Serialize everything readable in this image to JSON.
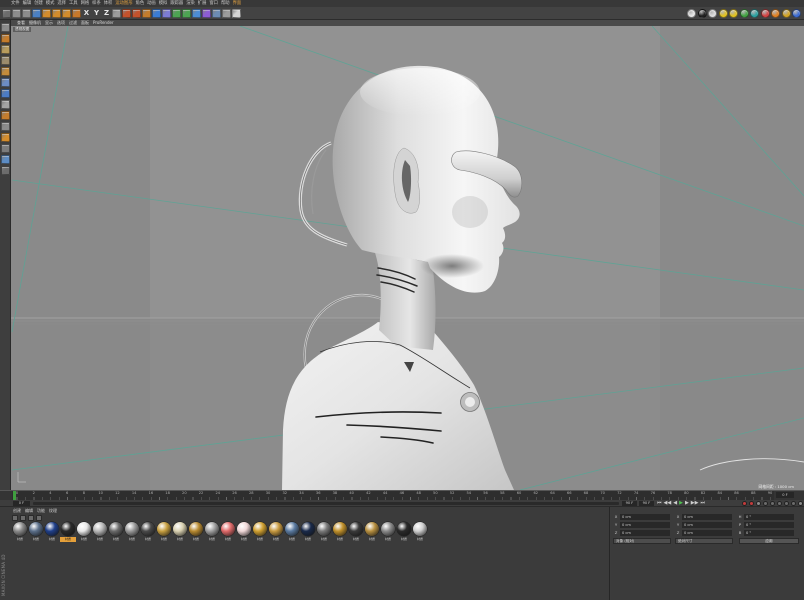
{
  "menubar": {
    "items": [
      {
        "label": "文件"
      },
      {
        "label": "编辑"
      },
      {
        "label": "创建"
      },
      {
        "label": "模式"
      },
      {
        "label": "选择"
      },
      {
        "label": "工具"
      },
      {
        "label": "网格"
      },
      {
        "label": "样条"
      },
      {
        "label": "体积"
      },
      {
        "label": "运动图形",
        "color": "#e0a040"
      },
      {
        "label": "角色"
      },
      {
        "label": "动画"
      },
      {
        "label": "模拟"
      },
      {
        "label": "跟踪器"
      },
      {
        "label": "渲染"
      },
      {
        "label": "扩展"
      },
      {
        "label": "窗口"
      },
      {
        "label": "帮助"
      },
      {
        "label": "界面",
        "color": "#e0a040"
      }
    ]
  },
  "toolbar": {
    "items": [
      {
        "icon": "layout-toggle-icon",
        "color": "#6c6c6c"
      },
      {
        "icon": "undo-icon",
        "color": "#8c8c8c"
      },
      {
        "icon": "redo-icon",
        "color": "#8c8c8c"
      },
      {
        "icon": "live-selection-icon",
        "color": "#4a80c4"
      },
      {
        "icon": "move-icon",
        "color": "#d38c2c"
      },
      {
        "icon": "scale-icon",
        "color": "#d38c2c"
      },
      {
        "icon": "rotate-icon",
        "color": "#d38c2c"
      },
      {
        "icon": "recent-tools-icon",
        "color": "#c7782a"
      },
      {
        "text": "X"
      },
      {
        "text": "Y"
      },
      {
        "text": "Z"
      },
      {
        "icon": "coordinate-system-icon",
        "color": "#9c9c9c"
      },
      {
        "icon": "render-view-icon",
        "color": "#c4522c"
      },
      {
        "icon": "render-picture-viewer-icon",
        "color": "#c4522c"
      },
      {
        "icon": "render-settings-icon",
        "color": "#c47c2c"
      },
      {
        "icon": "cube-icon",
        "color": "#3a7cd4"
      },
      {
        "icon": "pen-icon",
        "color": "#7c7cd4"
      },
      {
        "icon": "subdivision-surface-icon",
        "color": "#4ca452"
      },
      {
        "icon": "array-icon",
        "color": "#4ca452"
      },
      {
        "icon": "cloner-icon",
        "color": "#4c8cd4"
      },
      {
        "icon": "deformer-icon",
        "color": "#8c5cd4"
      },
      {
        "icon": "floor-icon",
        "color": "#6c8cb4"
      },
      {
        "icon": "camera-icon",
        "color": "#9c9c9c"
      },
      {
        "icon": "light-icon",
        "color": "#d4d4d4"
      }
    ],
    "right_icons": [
      {
        "icon": "viewport-layout-icon",
        "color": "#e6e6e6"
      },
      {
        "icon": "lock-icon",
        "color": "#222222"
      },
      {
        "icon": "sphere-display-icon",
        "color": "#dcdcdc"
      },
      {
        "icon": "sun-icon",
        "color": "#e2c222"
      },
      {
        "icon": "gear-icon",
        "color": "#e2c222"
      },
      {
        "icon": "palette-icon",
        "color": "#42a442"
      },
      {
        "icon": "nodes-icon",
        "color": "#2ca2a2"
      },
      {
        "icon": "record-icon",
        "color": "#d44444"
      },
      {
        "icon": "flame-icon",
        "color": "#e28222"
      },
      {
        "icon": "star-icon",
        "color": "#d4a422"
      },
      {
        "icon": "globe-icon",
        "color": "#3c6cd4"
      }
    ]
  },
  "left_toolbar": {
    "items": [
      {
        "icon": "make-editable-icon",
        "color": "#8c8c8c"
      },
      {
        "icon": "model-mode-icon",
        "color": "#c47c2c"
      },
      {
        "icon": "texture-mode-icon",
        "color": "#b89c5c"
      },
      {
        "icon": "workplane-icon",
        "color": "#9c8c6c"
      },
      {
        "icon": "points-mode-icon",
        "color": "#c48c3c"
      },
      {
        "icon": "edges-mode-icon",
        "color": "#6c8cc4"
      },
      {
        "icon": "polygons-mode-icon",
        "color": "#4c7cc4"
      },
      {
        "icon": "axis-mode-icon",
        "color": "#a4a4a4"
      },
      {
        "icon": "tweak-mode-icon",
        "color": "#c47c2c"
      },
      {
        "icon": "snap-icon",
        "color": "#8c8c8c"
      },
      {
        "icon": "solo-icon",
        "color": "#d48c2c"
      },
      {
        "icon": "lock-workplane-icon",
        "color": "#7c7c7c"
      },
      {
        "icon": "planar-workplane-icon",
        "color": "#5c8cc4"
      },
      {
        "icon": "quantize-icon",
        "color": "#6c6c6c"
      }
    ]
  },
  "viewport": {
    "menu": [
      "查看",
      "摄像机",
      "显示",
      "选项",
      "过滤",
      "面板",
      "ProRender"
    ],
    "view_label": "透视视图",
    "grid_spacing": "网格间距 : 1000 cm"
  },
  "timeline": {
    "ticks": [
      0,
      2,
      4,
      6,
      8,
      10,
      12,
      14,
      16,
      18,
      20,
      22,
      24,
      26,
      28,
      30,
      32,
      34,
      36,
      38,
      40,
      42,
      44,
      46,
      48,
      50,
      52,
      54,
      56,
      58,
      60,
      62,
      64,
      66,
      68,
      70,
      72,
      74,
      76,
      78,
      80,
      82,
      84,
      86,
      88,
      90
    ],
    "current_frame": "0 F"
  },
  "transport": {
    "start": "0 F",
    "preview_end": "90 F",
    "end": "90 F",
    "buttons": [
      "goto-start-icon",
      "previous-key-icon",
      "previous-frame-icon",
      "play-icon",
      "next-frame-icon",
      "next-key-icon",
      "goto-end-icon"
    ],
    "record_icons": [
      {
        "icon": "record-active-icon",
        "color": "#c43c3c"
      },
      {
        "icon": "autokey-icon",
        "color": "#c43c3c"
      },
      {
        "icon": "keyframe-selection-icon",
        "color": "#8c8c8c"
      },
      {
        "icon": "position-key-icon",
        "color": "#6c6c6c"
      },
      {
        "icon": "scale-key-icon",
        "color": "#6c6c6c"
      },
      {
        "icon": "rotation-key-icon",
        "color": "#6c6c6c"
      },
      {
        "icon": "parameter-key-icon",
        "color": "#6c6c6c"
      },
      {
        "icon": "point-key-icon",
        "color": "#6c6c6c"
      },
      {
        "icon": "timeline-icon",
        "color": "#8c8c8c"
      }
    ]
  },
  "materials": {
    "menu": [
      "创建",
      "编辑",
      "功能",
      "纹理"
    ],
    "tools": [
      "new-material-icon",
      "grid-view-icon",
      "search-icon",
      "list-view-icon"
    ],
    "selected_index": 3,
    "items": [
      {
        "label": "材质",
        "color": "#8a8a8a"
      },
      {
        "label": "材质",
        "color": "#5b6f8a"
      },
      {
        "label": "材质",
        "color": "#1f3f8a"
      },
      {
        "label": "材质",
        "color": "#2a2a2a"
      },
      {
        "label": "材质",
        "color": "#e8e8e8"
      },
      {
        "label": "材质",
        "color": "#b8b8b8"
      },
      {
        "label": "材质",
        "color": "#6a6a6a"
      },
      {
        "label": "材质",
        "color": "#9a9a9a"
      },
      {
        "label": "材质",
        "color": "#4a4a4a"
      },
      {
        "label": "材质",
        "color": "#c8a040"
      },
      {
        "label": "材质",
        "color": "#d8d0b0"
      },
      {
        "label": "材质",
        "color": "#b88a30"
      },
      {
        "label": "材质",
        "color": "#a0a0a0"
      },
      {
        "label": "材质",
        "color": "#e06a6a"
      },
      {
        "label": "材质",
        "color": "#f0d8d8"
      },
      {
        "label": "材质",
        "color": "#d0a030"
      },
      {
        "label": "材质",
        "color": "#c89a40"
      },
      {
        "label": "材质",
        "color": "#5a7aa0"
      },
      {
        "label": "材质",
        "color": "#1a2a4a"
      },
      {
        "label": "材质",
        "color": "#7a7a7a"
      },
      {
        "label": "材质",
        "color": "#c0902a"
      },
      {
        "label": "材质",
        "color": "#3a3a3a"
      },
      {
        "label": "材质",
        "color": "#b89040"
      },
      {
        "label": "材质",
        "color": "#8a8a8a"
      },
      {
        "label": "材质",
        "color": "#2a2a2a"
      },
      {
        "label": "材质",
        "color": "#cfcfcf"
      }
    ]
  },
  "coordinates": {
    "rows": [
      [
        {
          "label": "X",
          "value": "0 cm"
        },
        {
          "label": "X",
          "value": "0 cm"
        },
        {
          "label": "H",
          "value": "0 °"
        }
      ],
      [
        {
          "label": "Y",
          "value": "0 cm"
        },
        {
          "label": "Y",
          "value": "0 cm"
        },
        {
          "label": "P",
          "value": "0 °"
        }
      ],
      [
        {
          "label": "Z",
          "value": "0 cm"
        },
        {
          "label": "Z",
          "value": "0 cm"
        },
        {
          "label": "B",
          "value": "0 °"
        }
      ]
    ],
    "mode": "对象 (相对)",
    "size_mode": "绝对尺寸",
    "apply": "应用"
  },
  "brand": "MAXON CINEMA 4D"
}
